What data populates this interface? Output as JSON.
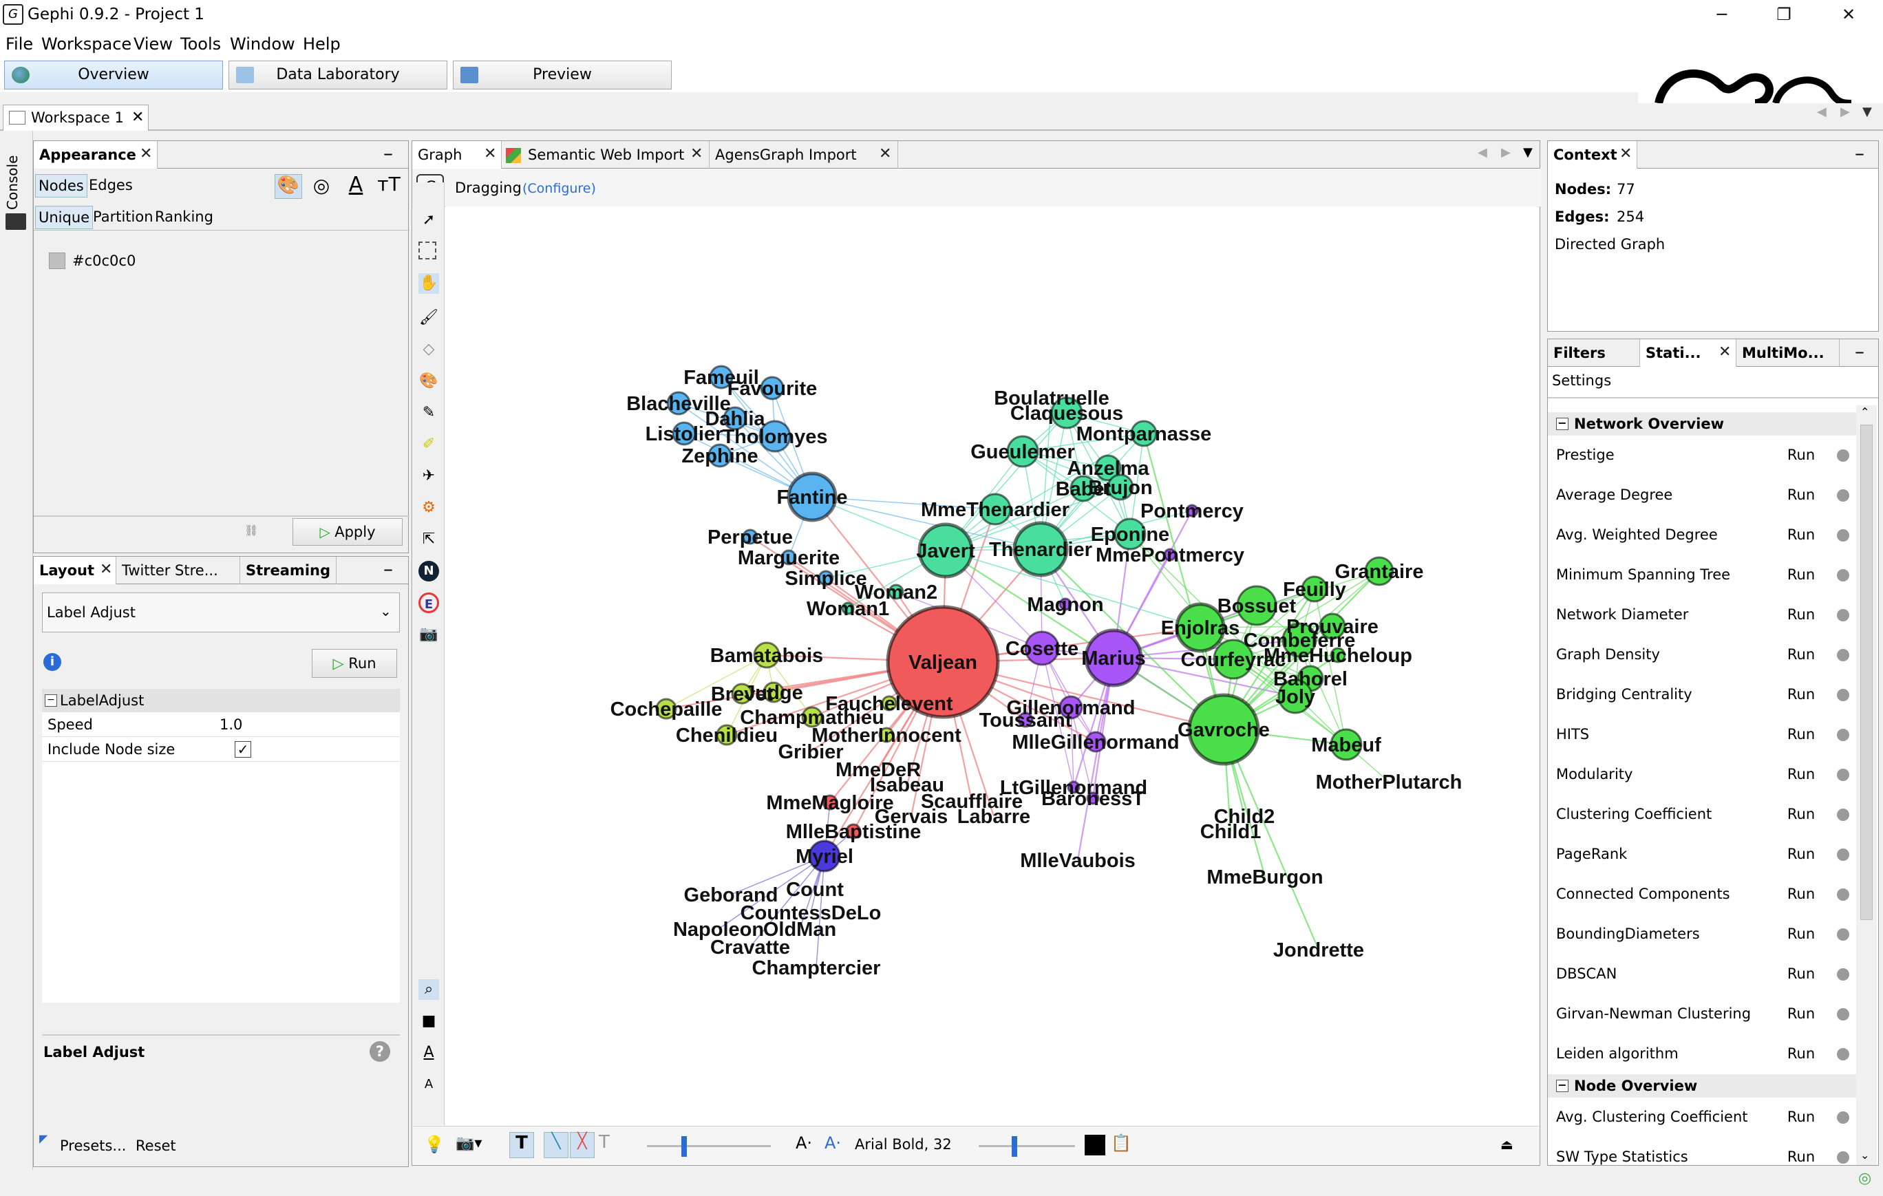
{
  "window": {
    "title": "Gephi 0.9.2 - Project 1",
    "minimize": "─",
    "restore": "❐",
    "close": "✕"
  },
  "menu": [
    "File",
    "Workspace",
    "View",
    "Tools",
    "Window",
    "Help"
  ],
  "modes": {
    "overview": "Overview",
    "data_lab": "Data Laboratory",
    "preview": "Preview"
  },
  "workspace_tab": "Workspace 1",
  "console_label": "Console",
  "appearance": {
    "title": "Appearance",
    "tabs": [
      "Nodes",
      "Edges"
    ],
    "subtabs": [
      "Unique",
      "Partition",
      "Ranking"
    ],
    "color_value": "#c0c0c0",
    "apply": "Apply"
  },
  "layout": {
    "tabs": [
      "Layout",
      "Twitter Stre...",
      "Streaming"
    ],
    "selected_algorithm": "Label Adjust",
    "run": "Run",
    "group": "LabelAdjust",
    "props": [
      {
        "name": "Speed",
        "value": "1.0"
      },
      {
        "name": "Include Node size",
        "value": ""
      }
    ],
    "desc_title": "Label Adjust",
    "presets": "Presets...",
    "reset": "Reset"
  },
  "graph_tabs": [
    "Graph",
    "Semantic Web Import",
    "AgensGraph Import"
  ],
  "graph_toolbar": {
    "mode": "Dragging",
    "configure": "(Configure)"
  },
  "bottom_bar": {
    "font": "Arial Bold, 32"
  },
  "context": {
    "title": "Context",
    "nodes_label": "Nodes:",
    "nodes": "77",
    "edges_label": "Edges:",
    "edges": "254",
    "graph_type": "Directed Graph"
  },
  "stats_panel": {
    "tabs": [
      "Filters",
      "Stati...",
      "MultiMo..."
    ],
    "settings": "Settings",
    "sections": [
      {
        "title": "Network Overview",
        "items": [
          "Prestige",
          "Average Degree",
          "Avg. Weighted Degree",
          "Minimum Spanning Tree",
          "Network Diameter",
          "Graph Density",
          "Bridging Centrality",
          "HITS",
          "Modularity",
          "Clustering Coefficient",
          "PageRank",
          "Connected Components",
          "BoundingDiameters",
          "DBSCAN",
          "Girvan-Newman Clustering",
          "Leiden algorithm"
        ]
      },
      {
        "title": "Node Overview",
        "items": [
          "Avg. Clustering Coefficient",
          "SW Type Statistics"
        ]
      }
    ],
    "run_label": "Run"
  },
  "colors": {
    "valjean": "#f15a5a",
    "purple": "#a855f7",
    "green": "#4ade4a",
    "teal": "#4ade9e",
    "blue": "#5ab4ef",
    "lime": "#b8e04a",
    "indigo": "#4b3adb"
  },
  "graph_labels": {
    "valjean": "Valjean",
    "marius": "Marius",
    "cosette": "Cosette",
    "gavroche": "Gavroche",
    "javert": "Javert",
    "thenardier": "Thenardier",
    "fantine": "Fantine",
    "enjolras": "Enjolras",
    "bossuet": "Bossuet",
    "courfeyrac": "Courfeyrac",
    "combeferre": "Combeferre",
    "feuilly": "Feuilly",
    "prouvaire": "Prouvaire",
    "grantaire": "Grantaire",
    "bahorel": "Bahorel",
    "joly": "Joly",
    "mmehucheloup": "MmeHucheloup",
    "mabeuf": "Mabeuf",
    "motherplutarch": "MotherPlutarch",
    "child2": "Child2",
    "child1": "Child1",
    "mmeburgon": "MmeBurgon",
    "jondrette": "Jondrette",
    "eponine": "Eponine",
    "mmepontmercy": "MmePontmercy",
    "pontmercy": "Pontmercy",
    "mmethenardier": "MmeThenardier",
    "boulatruelle": "Boulatruelle",
    "claquesous": "Claquesous",
    "montparnasse": "Montparnasse",
    "gueulemer": "Gueulemer",
    "anzelma": "Anzelma",
    "babet": "Babet",
    "brujon": "Brujon",
    "magnon": "Magnon",
    "gillenormand": "Gillenormand",
    "mllegillenormand": "MlleGillenormand",
    "ltgillenormand": "LtGillenormand",
    "baronesst": "BaronessT",
    "mllevaubois": "MlleVaubois",
    "toussaint": "Toussaint",
    "fameuil": "Fameuil",
    "favourite": "Favourite",
    "blacheville": "Blacheville",
    "dahlia": "Dahlia",
    "listolier": "Listolier",
    "tholomyes": "Tholomyes",
    "zephine": "Zephine",
    "perpetue": "Perpetue",
    "marguerite": "Marguerite",
    "simplice": "Simplice",
    "woman2": "Woman2",
    "woman1": "Woman1",
    "bamatabois": "Bamatabois",
    "brevet": "Brevet",
    "judge": "Judge",
    "fauchelevent": "Fauchelevent",
    "cochepaille": "Cochepaille",
    "champmathieu": "Champmathieu",
    "chenildieu": "Chenildieu",
    "motherinnocent": "MotherInnocent",
    "gribier": "Gribier",
    "mmeder": "MmeDeR",
    "isabeau": "Isabeau",
    "scaufflaire": "Scaufflaire",
    "gervais": "Gervais",
    "labarre": "Labarre",
    "mmemagloire": "MmeMagloire",
    "mllebaptistine": "MlleBaptistine",
    "myriel": "Myriel",
    "geborand": "Geborand",
    "count": "Count",
    "countessdelo": "CountessDeLo",
    "napoleon": "Napoleon",
    "oldman": "OldMan",
    "cravatte": "Cravatte",
    "champtercier": "Champtercier"
  }
}
